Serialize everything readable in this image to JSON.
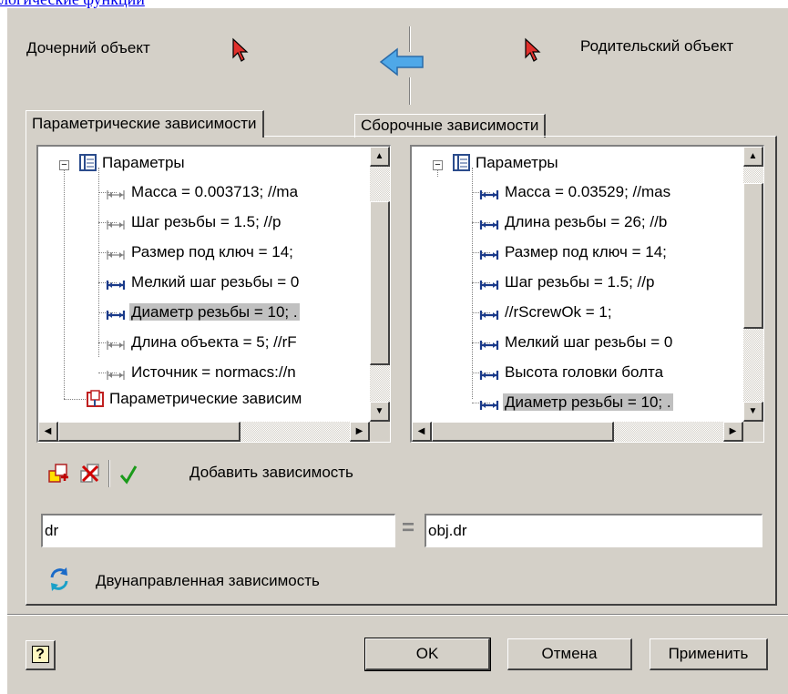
{
  "top_link": "логические функции",
  "header": {
    "child_label": "Дочерний объект",
    "parent_label": "Родительский объект"
  },
  "tabs": [
    {
      "label": "Параметрические зависимости",
      "active": true
    },
    {
      "label": "Сборочные зависимости",
      "active": false
    }
  ],
  "left_tree": {
    "root": "Параметры",
    "items": [
      {
        "text": "Масса = 0.003713; //ma",
        "bold_icon": false
      },
      {
        "text": "Шаг резьбы = 1.5; //p",
        "bold_icon": false
      },
      {
        "text": "Размер под ключ = 14;",
        "bold_icon": false
      },
      {
        "text": "Мелкий шаг резьбы = 0",
        "bold_icon": true
      },
      {
        "text": "Диаметр резьбы = 10; .",
        "bold_icon": true,
        "selected": true
      },
      {
        "text": "Длина объекта = 5; //rF",
        "bold_icon": false
      },
      {
        "text": "Источник = normacs://n",
        "bold_icon": false
      }
    ],
    "second_root": "Параметрические зависим"
  },
  "right_tree": {
    "root": "Параметры",
    "items": [
      {
        "text": "Масса = 0.03529; //mas"
      },
      {
        "text": "Длина резьбы = 26; //b"
      },
      {
        "text": "Размер под ключ = 14;"
      },
      {
        "text": "Шаг резьбы = 1.5; //p"
      },
      {
        "text": " //rScrewOk = 1;"
      },
      {
        "text": "Мелкий шаг резьбы = 0"
      },
      {
        "text": "Высота головки болта"
      },
      {
        "text": "Диаметр резьбы = 10; .",
        "selected": true
      }
    ]
  },
  "toolbar": {
    "add_dependency_label": "Добавить зависимость"
  },
  "expression": {
    "left_value": "dr",
    "equals": "=",
    "right_value": "obj.dr"
  },
  "bidirectional_label": "Двунаправленная зависимость",
  "buttons": {
    "ok": "OK",
    "cancel": "Отмена",
    "apply": "Применить",
    "help": "?"
  },
  "colors": {
    "dialog_bg": "#d4d0c8",
    "arrow_blue": "#4fa8e8",
    "cursor_red": "#e0302c",
    "link_blue": "#0000ee",
    "check_green": "#1a9a1a"
  }
}
